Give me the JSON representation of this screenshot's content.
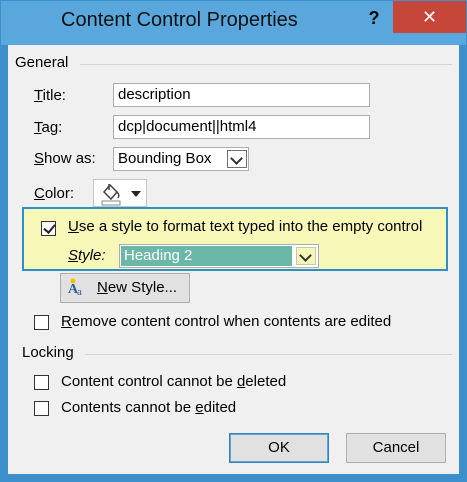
{
  "window": {
    "title": "Content Control Properties",
    "help_label": "?",
    "close_label": "✕"
  },
  "general": {
    "header": "General",
    "title_label": "Title:",
    "title_label_key": "T",
    "title_label_rest": "itle:",
    "title_value": "description",
    "tag_label_key": "T",
    "tag_label_rest": "ag:",
    "tag_value": "dcp|document||html4",
    "showas_label_key": "S",
    "showas_label_rest": "how as:",
    "showas_value": "Bounding Box",
    "color_label_key": "C",
    "color_label_rest": "olor:",
    "use_style_key": "U",
    "use_style_rest": "se a style to format text typed into the empty control",
    "use_style_checked": true,
    "style_label_key": "S",
    "style_label_rest": "tyle:",
    "style_value": "Heading 2",
    "new_style_key": "N",
    "new_style_rest": "ew Style...",
    "remove_key": "R",
    "remove_rest": "emove content control when contents are edited",
    "remove_checked": false
  },
  "locking": {
    "header": "Locking",
    "cannot_delete_pre": "Content control cannot be ",
    "cannot_delete_key": "d",
    "cannot_delete_post": "eleted",
    "cannot_delete_checked": false,
    "cannot_edit_pre": "Contents cannot be ",
    "cannot_edit_key": "e",
    "cannot_edit_post": "dited",
    "cannot_edit_checked": false
  },
  "buttons": {
    "ok": "OK",
    "cancel": "Cancel"
  },
  "colors": {
    "title_bar": "#5aa7dd",
    "close_button": "#c7463a",
    "highlight_group": "#f7f7b8",
    "highlight_border": "#2c8fcb",
    "selected_style": "#6bb8a8"
  }
}
